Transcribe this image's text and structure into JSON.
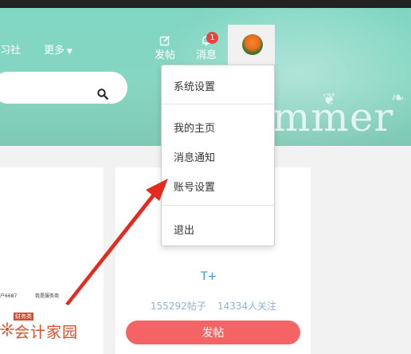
{
  "nav": {
    "items": [
      {
        "label": "习社"
      },
      {
        "label": "更多"
      }
    ],
    "compose_label": "发帖",
    "messages_label": "消息",
    "messages_badge": "1"
  },
  "banner": {
    "word": "mmer"
  },
  "dropdown": {
    "items": [
      "系统设置",
      "我的主页",
      "消息通知",
      "账号设置",
      "退出"
    ]
  },
  "left_card": {
    "texts": [
      "户6687",
      "我是服务商"
    ],
    "logo_tag": "财务类",
    "logo_text": "会计家园"
  },
  "right_card": {
    "tplus": "T+",
    "posts": "155292帖子",
    "follows": "14334人关注",
    "post_button": "发帖"
  },
  "colors": {
    "header": "#86d6c2",
    "accent_red": "#f56464",
    "badge": "#e9423f",
    "link_blue": "#4a90d9"
  }
}
